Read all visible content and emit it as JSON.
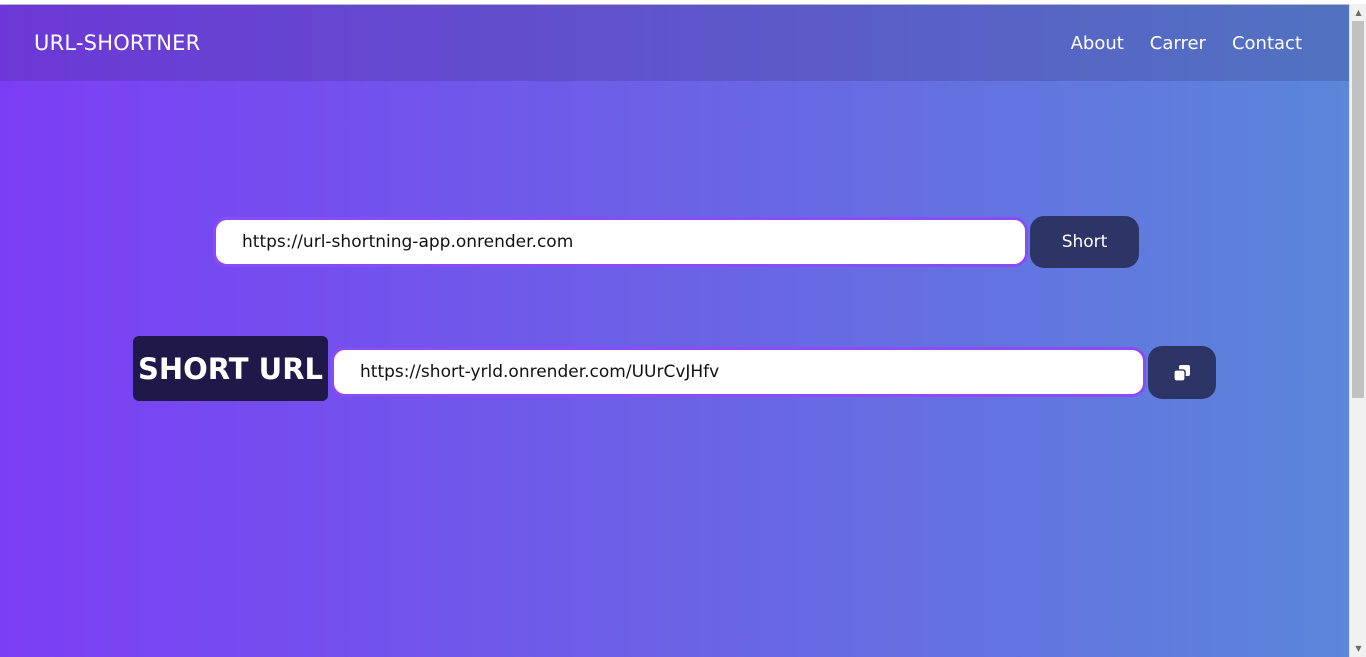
{
  "navbar": {
    "brand": "URL-SHORTNER",
    "links": [
      "About",
      "Carrer",
      "Contact"
    ]
  },
  "shortener": {
    "input_value": "https://url-shortning-app.onrender.com",
    "button_label": "Short"
  },
  "result": {
    "label": "SHORT URL",
    "value": "https://short-yrld.onrender.com/UUrCvJHfv",
    "copy_icon": "copy-icon"
  },
  "colors": {
    "gradient_start": "#7c3ef5",
    "gradient_end": "#5b86da",
    "button_bg": "#2d3566",
    "label_bg": "#21184a",
    "input_border": "#8a4cf7"
  },
  "scrollbar": {
    "up_icon": "scroll-up-arrow-icon",
    "down_icon": "scroll-down-arrow-icon"
  }
}
